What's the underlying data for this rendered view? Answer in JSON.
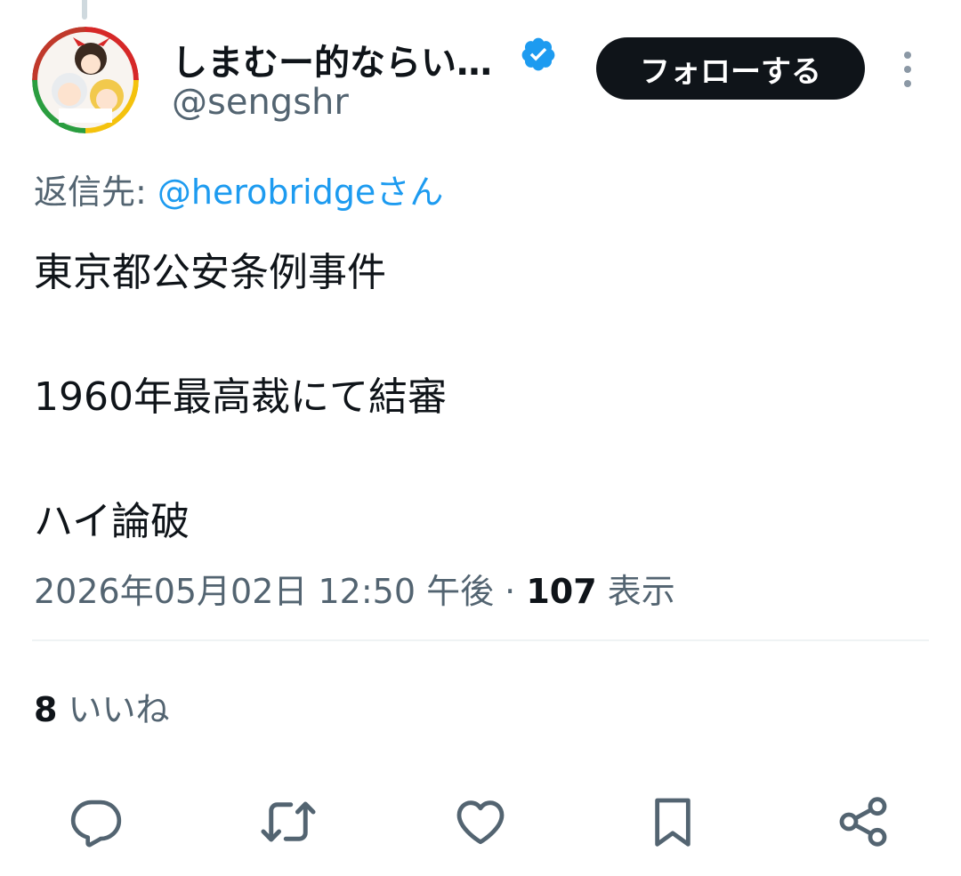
{
  "tweet": {
    "author": {
      "display_name": "しまむー的ならい…",
      "handle": "@sengshr"
    },
    "follow_label": "フォローする",
    "reply_to": {
      "prefix": "返信先: ",
      "mention": "@herobridgeさん"
    },
    "lines": [
      "東京都公安条例事件",
      "1960年最高裁にて結審",
      "ハイ論破"
    ],
    "timestamp": "2026年05月02日 12:50 午後 · ",
    "views": {
      "count": "107",
      "label": " 表示"
    },
    "likes": {
      "count": "8",
      "label": " いいね"
    }
  },
  "icons": {
    "verified": "verified-badge-icon",
    "more": "more-vertical-icon",
    "reply": "reply-icon",
    "retweet": "retweet-icon",
    "like": "heart-icon",
    "bookmark": "bookmark-icon",
    "share": "share-icon"
  },
  "colors": {
    "accent": "#1d9bf0",
    "text": "#0f1419",
    "secondary": "#536471",
    "follow_button_bg": "#0f1419"
  }
}
